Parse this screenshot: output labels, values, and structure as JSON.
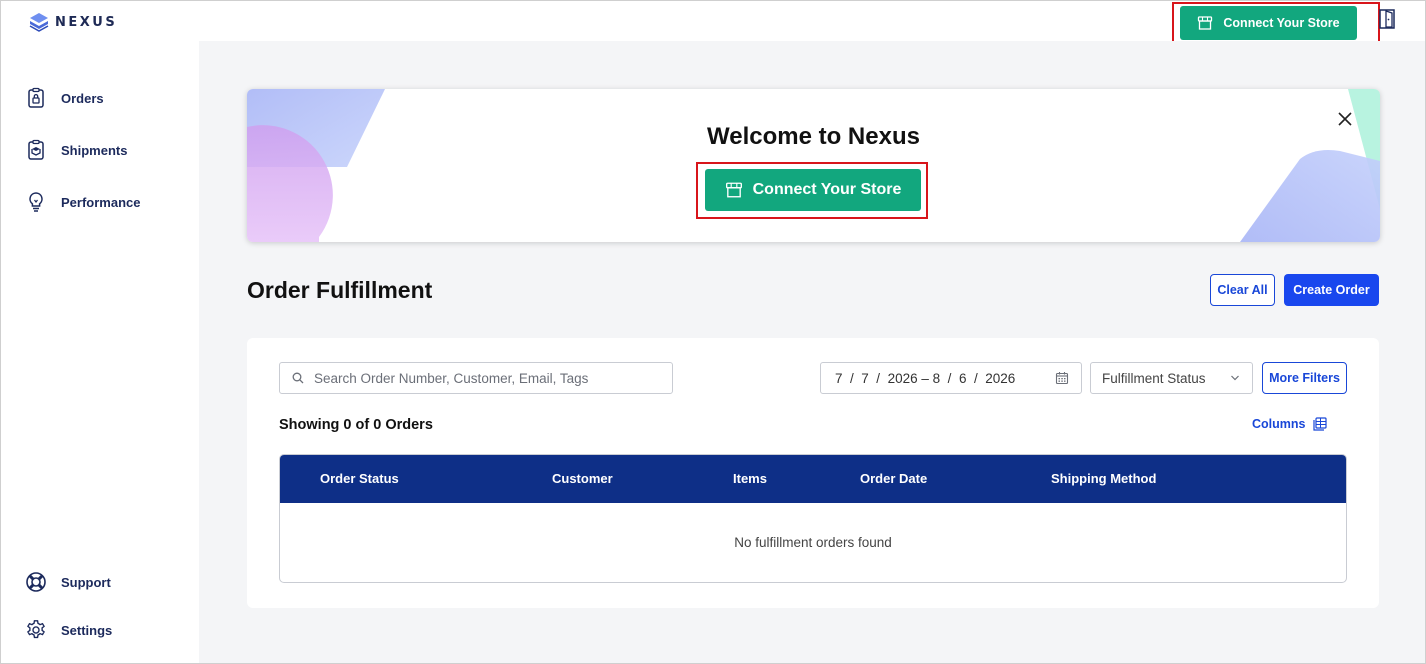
{
  "app": {
    "brand": "NEXUS"
  },
  "header": {
    "connect_label": "Connect Your Store",
    "colors": {
      "accent_green": "#12a77e",
      "highlight_red": "#d8151b"
    }
  },
  "sidebar": {
    "items": [
      {
        "label": "Orders",
        "icon": "clipboard-lock-icon"
      },
      {
        "label": "Shipments",
        "icon": "package-list-icon"
      },
      {
        "label": "Performance",
        "icon": "lightbulb-icon"
      },
      {
        "label": "Support",
        "icon": "lifebuoy-icon"
      },
      {
        "label": "Settings",
        "icon": "gear-icon"
      }
    ]
  },
  "banner": {
    "title": "Welcome to Nexus",
    "connect_label": "Connect Your Store"
  },
  "main": {
    "title": "Order Fulfillment",
    "clear_all_label": "Clear All",
    "create_order_label": "Create Order"
  },
  "filters": {
    "search_placeholder": "Search Order Number, Customer, Email, Tags",
    "date_start": {
      "month": "7",
      "day": "7",
      "year": "2026"
    },
    "date_end": {
      "month": "8",
      "day": "6",
      "year": "2026"
    },
    "date_separator": "–",
    "status_label": "Fulfillment Status",
    "more_filters_label": "More Filters"
  },
  "orders": {
    "showing_text": "Showing 0 of 0 Orders",
    "columns_label": "Columns",
    "headers": [
      "Order Status",
      "Customer",
      "Items",
      "Order Date",
      "Shipping Method"
    ],
    "empty_text": "No fulfillment orders found"
  }
}
